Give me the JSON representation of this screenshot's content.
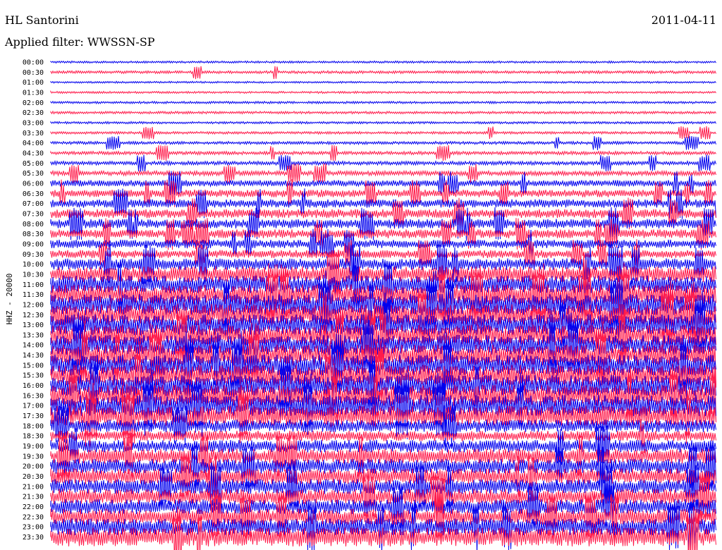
{
  "header": {
    "station": "HL Santorini",
    "date": "2011-04-11",
    "filter_line": "Applied filter: WWSSN-SP"
  },
  "chart_data": {
    "type": "line",
    "title": "HL Santorini",
    "subtitle": "Applied filter: WWSSN-SP",
    "date": "2011-04-11",
    "ylabel": "HHZ - 20000",
    "xlabel": "",
    "grid": false,
    "colors": [
      "#0000ee",
      "#ff1a4a"
    ],
    "rows": [
      {
        "time": "00:00",
        "color": "#0000ee",
        "amplitude": 0.1,
        "burst_rate": 0.0
      },
      {
        "time": "00:30",
        "color": "#ff1a4a",
        "amplitude": 0.13,
        "burst_rate": 0.002
      },
      {
        "time": "01:00",
        "color": "#0000ee",
        "amplitude": 0.09,
        "burst_rate": 0.0
      },
      {
        "time": "01:30",
        "color": "#ff1a4a",
        "amplitude": 0.1,
        "burst_rate": 0.0
      },
      {
        "time": "02:00",
        "color": "#0000ee",
        "amplitude": 0.11,
        "burst_rate": 0.001
      },
      {
        "time": "02:30",
        "color": "#ff1a4a",
        "amplitude": 0.12,
        "burst_rate": 0.001
      },
      {
        "time": "03:00",
        "color": "#0000ee",
        "amplitude": 0.11,
        "burst_rate": 0.001
      },
      {
        "time": "03:30",
        "color": "#ff1a4a",
        "amplitude": 0.12,
        "burst_rate": 0.002
      },
      {
        "time": "04:00",
        "color": "#0000ee",
        "amplitude": 0.14,
        "burst_rate": 0.004
      },
      {
        "time": "04:30",
        "color": "#ff1a4a",
        "amplitude": 0.16,
        "burst_rate": 0.005
      },
      {
        "time": "05:00",
        "color": "#0000ee",
        "amplitude": 0.18,
        "burst_rate": 0.006
      },
      {
        "time": "05:30",
        "color": "#ff1a4a",
        "amplitude": 0.22,
        "burst_rate": 0.012
      },
      {
        "time": "06:00",
        "color": "#0000ee",
        "amplitude": 0.3,
        "burst_rate": 0.016
      },
      {
        "time": "06:30",
        "color": "#ff1a4a",
        "amplitude": 0.36,
        "burst_rate": 0.018
      },
      {
        "time": "07:00",
        "color": "#0000ee",
        "amplitude": 0.4,
        "burst_rate": 0.018
      },
      {
        "time": "07:30",
        "color": "#ff1a4a",
        "amplitude": 0.42,
        "burst_rate": 0.016
      },
      {
        "time": "08:00",
        "color": "#0000ee",
        "amplitude": 0.45,
        "burst_rate": 0.016
      },
      {
        "time": "08:30",
        "color": "#ff1a4a",
        "amplitude": 0.42,
        "burst_rate": 0.014
      },
      {
        "time": "09:00",
        "color": "#0000ee",
        "amplitude": 0.4,
        "burst_rate": 0.012
      },
      {
        "time": "09:30",
        "color": "#ff1a4a",
        "amplitude": 0.38,
        "burst_rate": 0.01
      },
      {
        "time": "10:00",
        "color": "#0000ee",
        "amplitude": 0.55,
        "burst_rate": 0.01
      },
      {
        "time": "10:30",
        "color": "#ff1a4a",
        "amplitude": 0.75,
        "burst_rate": 0.01
      },
      {
        "time": "11:00",
        "color": "#0000ee",
        "amplitude": 0.85,
        "burst_rate": 0.008
      },
      {
        "time": "11:30",
        "color": "#ff1a4a",
        "amplitude": 0.95,
        "burst_rate": 0.008
      },
      {
        "time": "12:00",
        "color": "#0000ee",
        "amplitude": 1.0,
        "burst_rate": 0.008
      },
      {
        "time": "12:30",
        "color": "#ff1a4a",
        "amplitude": 1.0,
        "burst_rate": 0.008
      },
      {
        "time": "13:00",
        "color": "#0000ee",
        "amplitude": 1.0,
        "burst_rate": 0.006
      },
      {
        "time": "13:30",
        "color": "#ff1a4a",
        "amplitude": 0.98,
        "burst_rate": 0.006
      },
      {
        "time": "14:00",
        "color": "#0000ee",
        "amplitude": 0.95,
        "burst_rate": 0.006
      },
      {
        "time": "14:30",
        "color": "#ff1a4a",
        "amplitude": 1.0,
        "burst_rate": 0.006
      },
      {
        "time": "15:00",
        "color": "#0000ee",
        "amplitude": 1.0,
        "burst_rate": 0.006
      },
      {
        "time": "15:30",
        "color": "#ff1a4a",
        "amplitude": 1.0,
        "burst_rate": 0.006
      },
      {
        "time": "16:00",
        "color": "#0000ee",
        "amplitude": 1.0,
        "burst_rate": 0.006
      },
      {
        "time": "16:30",
        "color": "#ff1a4a",
        "amplitude": 1.0,
        "burst_rate": 0.006
      },
      {
        "time": "17:00",
        "color": "#0000ee",
        "amplitude": 1.0,
        "burst_rate": 0.004
      },
      {
        "time": "17:30",
        "color": "#ff1a4a",
        "amplitude": 0.95,
        "burst_rate": 0.004
      },
      {
        "time": "18:00",
        "color": "#0000ee",
        "amplitude": 0.6,
        "burst_rate": 0.004
      },
      {
        "time": "18:30",
        "color": "#ff1a4a",
        "amplitude": 0.5,
        "burst_rate": 0.006
      },
      {
        "time": "19:00",
        "color": "#0000ee",
        "amplitude": 0.6,
        "burst_rate": 0.008
      },
      {
        "time": "19:30",
        "color": "#ff1a4a",
        "amplitude": 0.7,
        "burst_rate": 0.008
      },
      {
        "time": "20:00",
        "color": "#0000ee",
        "amplitude": 0.7,
        "burst_rate": 0.008
      },
      {
        "time": "20:30",
        "color": "#ff1a4a",
        "amplitude": 0.75,
        "burst_rate": 0.008
      },
      {
        "time": "21:00",
        "color": "#0000ee",
        "amplitude": 0.7,
        "burst_rate": 0.008
      },
      {
        "time": "21:30",
        "color": "#ff1a4a",
        "amplitude": 0.72,
        "burst_rate": 0.008
      },
      {
        "time": "22:00",
        "color": "#0000ee",
        "amplitude": 0.7,
        "burst_rate": 0.008
      },
      {
        "time": "22:30",
        "color": "#ff1a4a",
        "amplitude": 0.75,
        "burst_rate": 0.008
      },
      {
        "time": "23:00",
        "color": "#0000ee",
        "amplitude": 0.8,
        "burst_rate": 0.008
      },
      {
        "time": "23:30",
        "color": "#ff1a4a",
        "amplitude": 0.9,
        "burst_rate": 0.008
      }
    ]
  }
}
